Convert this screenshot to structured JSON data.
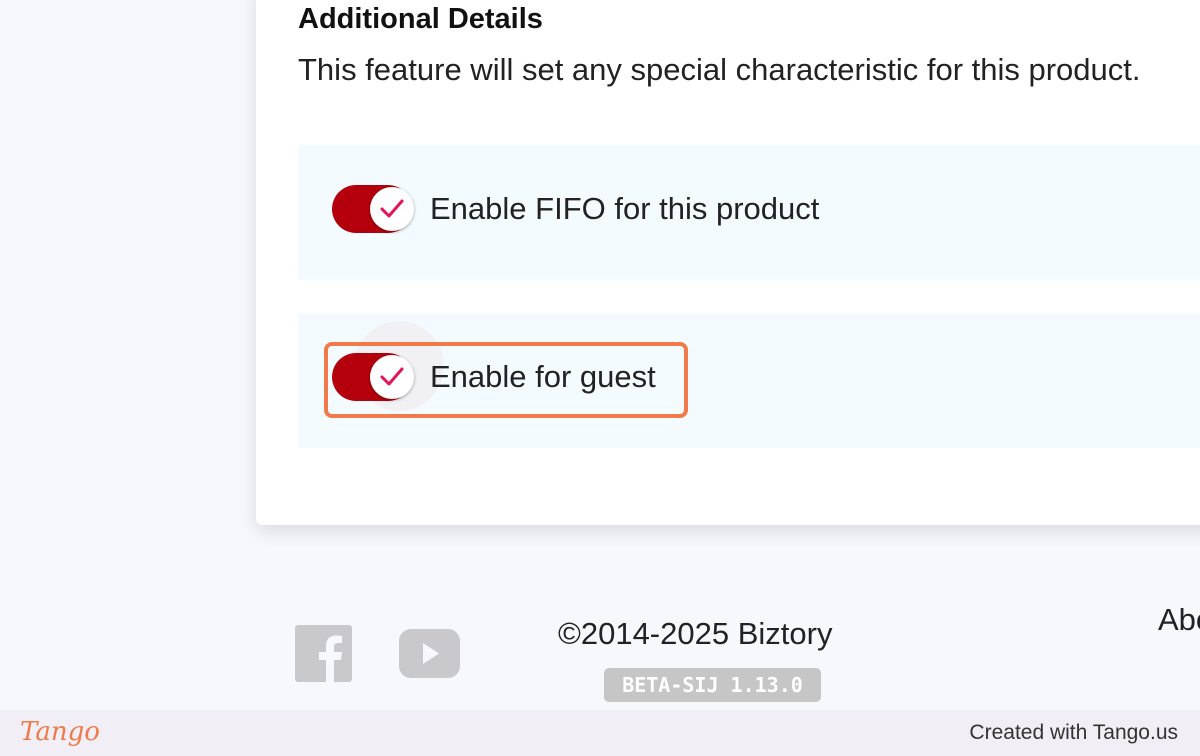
{
  "section": {
    "title": "Additional Details",
    "description": "This feature will set any special characteristic for this product."
  },
  "options": [
    {
      "label": "Enable FIFO for this product",
      "enabled": true
    },
    {
      "label": "Enable for guest",
      "enabled": true
    }
  ],
  "footer": {
    "copyright": "©2014-2025 Biztory",
    "version": "BETA-SIJ 1.13.0",
    "about_link": "About",
    "social": [
      "facebook-icon",
      "youtube-icon"
    ]
  },
  "tango": {
    "logo": "Tango",
    "credit": "Created with Tango.us"
  },
  "colors": {
    "toggle_on": "#b4000c",
    "check_mark": "#e5135c",
    "highlight": "#f07a4a",
    "row_bg": "#f4fbfe"
  }
}
